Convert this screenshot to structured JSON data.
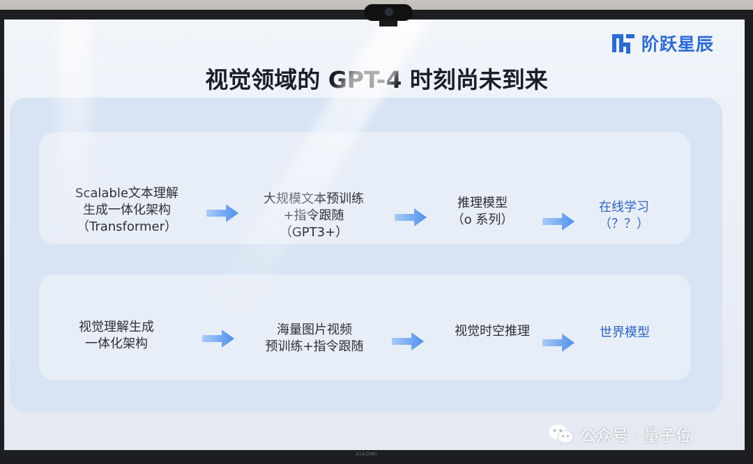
{
  "slide": {
    "title": "视觉领域的 GPT-4 时刻尚未到来",
    "logo_text": "阶跃星辰",
    "rows": [
      {
        "steps": [
          {
            "lines": [
              "Scalable文本理解",
              "生成一体化架构",
              "（Transformer）"
            ]
          },
          {
            "lines": [
              "大规模文本预训练",
              "+指令跟随",
              "（GPT3+）"
            ]
          },
          {
            "lines": [
              "推理模型",
              "（o 系列）"
            ]
          },
          {
            "lines": [
              "在线学习",
              "（？？）"
            ],
            "highlight": true
          }
        ]
      },
      {
        "steps": [
          {
            "lines": [
              "视觉理解生成",
              "一体化架构"
            ]
          },
          {
            "lines": [
              "海量图片视频",
              "预训练+指令跟随"
            ]
          },
          {
            "lines": [
              "视觉时空推理"
            ]
          },
          {
            "lines": [
              "世界模型"
            ],
            "highlight": true
          }
        ]
      }
    ]
  },
  "tv": {
    "brand_label": "XIAOMI"
  },
  "watermark": {
    "text": "公众号 · 量子位"
  },
  "colors": {
    "accent_blue": "#2b63c8",
    "logo_blue": "#2a6ad8",
    "arrow_blue": "#5b9cf0",
    "panel_outer": "#d8e4f3",
    "panel_inner": "#e8eef7"
  },
  "icons": [
    "webcam-icon",
    "stepfun-logo-icon",
    "right-arrow-icon",
    "wechat-icon"
  ]
}
